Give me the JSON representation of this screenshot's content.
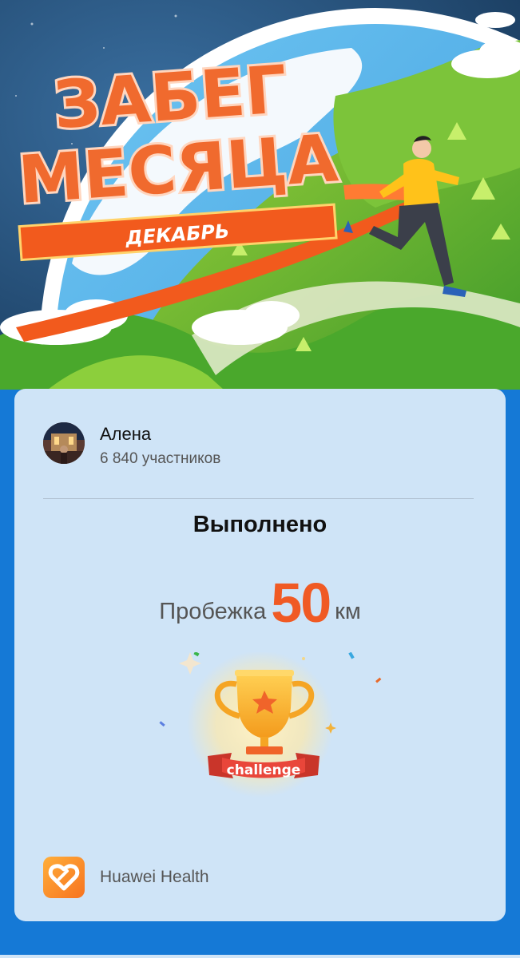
{
  "banner": {
    "title_line1": "ЗАБЕГ",
    "title_line2": "МЕСЯЦА",
    "month": "ДЕКАБРЬ"
  },
  "profile": {
    "name": "Алена",
    "participants": "6 840 участников"
  },
  "challenge": {
    "status": "Выполнено",
    "activity": "Пробежка",
    "distance": "50",
    "unit": "км",
    "badge_text": "challenge"
  },
  "footer": {
    "app_name": "Huawei Health",
    "app_icon": "huawei-health-icon"
  },
  "colors": {
    "accent": "#f05a24",
    "background": "#1579d6",
    "card": "#cfe4f7"
  }
}
